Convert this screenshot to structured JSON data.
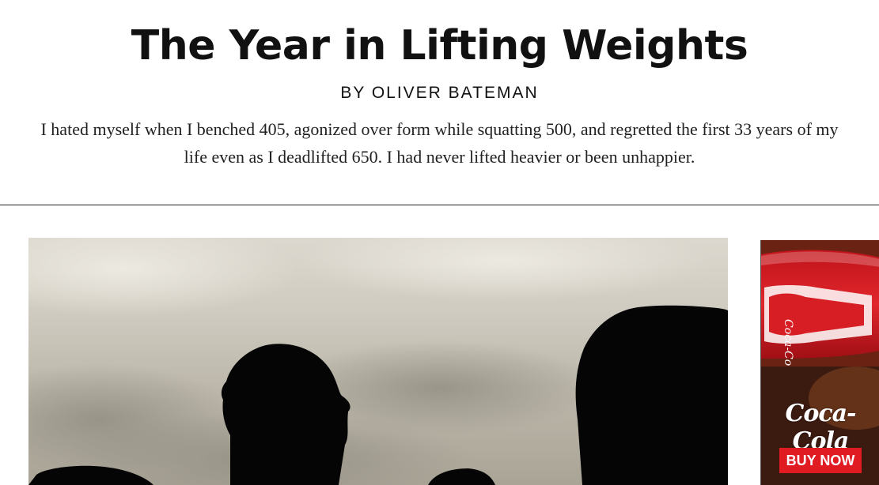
{
  "article": {
    "title": "The Year in Lifting Weights",
    "byline": "BY OLIVER BATEMAN",
    "dek": "I hated myself when I benched 405, agonized over form while squatting 500, and regretted the first 33 years of my life even as I deadlifted 650. I had never lifted heavier or been unhappier."
  },
  "hero_image": {
    "icon": "silhouettes-photo"
  },
  "ad": {
    "brand": "Coca-Cola",
    "cta": "BUY NOW",
    "colors": {
      "brand_red": "#e01b22"
    }
  }
}
